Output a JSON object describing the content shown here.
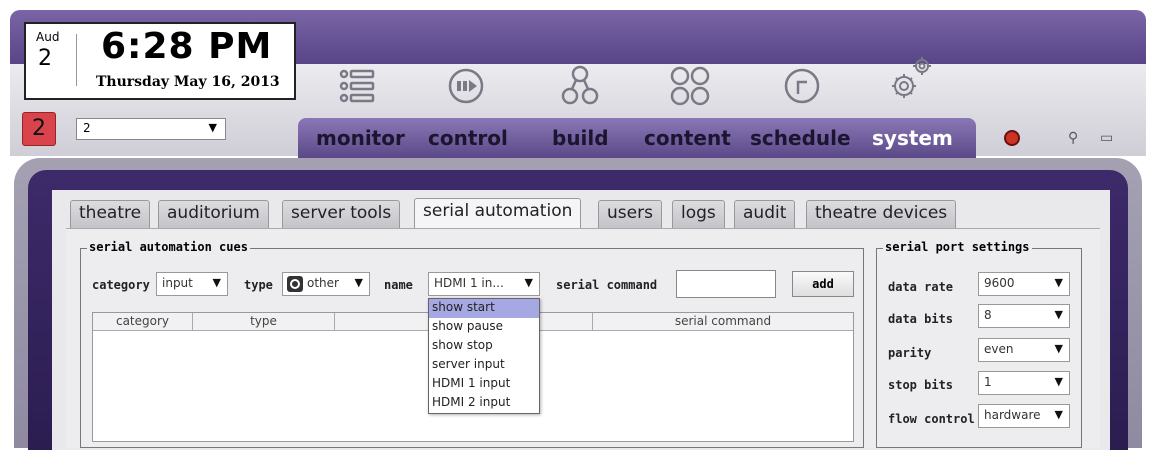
{
  "clock": {
    "month": "Aud",
    "day": "2",
    "time": "6:28 PM",
    "date": "Thursday May 16, 2013"
  },
  "room": {
    "badge": "2",
    "selected": "2"
  },
  "nav": {
    "icons": [
      "list-icon",
      "play-circle-icon",
      "build-icon",
      "content-icon",
      "schedule-icon",
      "gear-icon"
    ],
    "tabs": [
      "monitor",
      "control",
      "build",
      "content",
      "schedule",
      "system"
    ],
    "active": "system"
  },
  "subtabs": [
    "theatre",
    "auditorium",
    "server tools",
    "serial automation",
    "users",
    "logs",
    "audit",
    "theatre devices"
  ],
  "cues": {
    "legend": "serial automation cues",
    "category_label": "category",
    "category_value": "input",
    "type_label": "type",
    "type_value": "other",
    "name_label": "name",
    "name_value": "HDMI 1 in...",
    "serial_command_label": "serial command",
    "add_label": "add",
    "columns": [
      "category",
      "type",
      "",
      "serial command"
    ],
    "name_options": [
      "show start",
      "show pause",
      "show stop",
      "server input",
      "HDMI 1 input",
      "HDMI 2 input"
    ],
    "highlighted_option": "show start"
  },
  "port": {
    "legend": "serial port settings",
    "data_rate_label": "data rate",
    "data_rate": "9600",
    "data_bits_label": "data bits",
    "data_bits": "8",
    "parity_label": "parity",
    "parity": "even",
    "stop_bits_label": "stop bits",
    "stop_bits": "1",
    "flow_control_label": "flow control",
    "flow_control": "hardware"
  },
  "colors": {
    "header_purple": "#5f4c8f",
    "active_tab": "#ffffff",
    "badge_red": "#d9444c",
    "highlight": "#a5a8e3"
  }
}
